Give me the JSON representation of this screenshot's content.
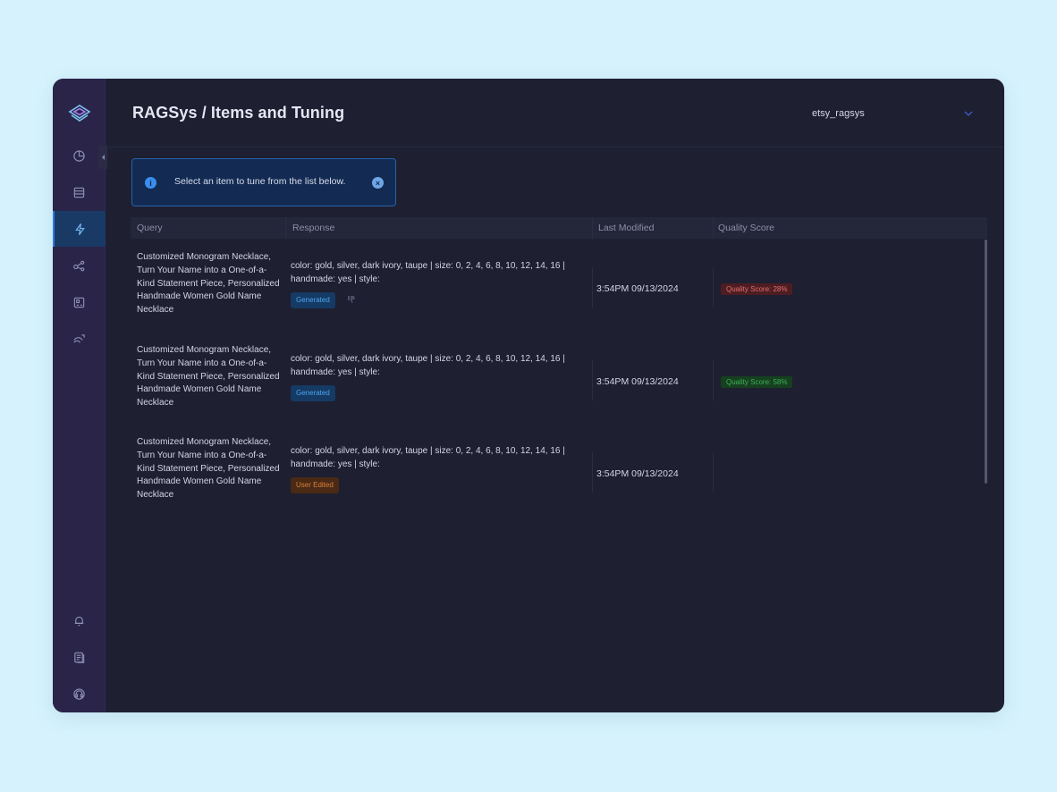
{
  "app": {
    "title": "RAGSys / Items and Tuning"
  },
  "workspace": {
    "selected": "etsy_ragsys"
  },
  "sidebar": {
    "items": [
      {
        "icon": "pie-chart-icon"
      },
      {
        "icon": "database-icon"
      },
      {
        "icon": "lightning-icon",
        "active": true
      },
      {
        "icon": "network-icon"
      },
      {
        "icon": "image-dashboard-icon"
      },
      {
        "icon": "wifi-pulse-icon"
      }
    ],
    "bottom": [
      {
        "icon": "bell-icon"
      },
      {
        "icon": "documents-icon"
      },
      {
        "icon": "headset-icon"
      }
    ]
  },
  "alert": {
    "message": "Select an item to tune from the list below.",
    "info_glyph": "i",
    "close_glyph": "×"
  },
  "table": {
    "headers": {
      "query": "Query",
      "response": "Response",
      "last_modified": "Last Modified",
      "quality_score": "Quality Score"
    },
    "rows": [
      {
        "query": "Customized Monogram Necklace, Turn Your Name into a One-of-a-Kind Statement Piece, Personalized Handmade Women Gold Name Necklace",
        "response": "color: gold, silver, dark ivory, taupe | size: 0, 2, 4, 6, 8, 10, 12, 14, 16 | handmade: yes | style:",
        "badge": "Generated",
        "last_modified": "3:54PM 09/13/2024",
        "quality_score": "Quality Score: 28%"
      },
      {
        "query": "Customized Monogram Necklace, Turn Your Name into a One-of-a-Kind Statement Piece, Personalized Handmade Women Gold Name Necklace",
        "response": "color: gold, silver, dark ivory, taupe | size: 0, 2, 4, 6, 8, 10, 12, 14, 16 | handmade: yes | style:",
        "badge": "Generated",
        "last_modified": "3:54PM 09/13/2024",
        "quality_score": "Quality Score: 58%"
      },
      {
        "query": "Customized Monogram Necklace, Turn Your Name into a One-of-a-Kind Statement Piece, Personalized Handmade Women Gold Name Necklace",
        "response": "color: gold, silver, dark ivory, taupe | size: 0, 2, 4, 6, 8, 10, 12, 14, 16 | handmade: yes | style:",
        "badge": "User Edited",
        "last_modified": "3:54PM 09/13/2024",
        "quality_score": ""
      }
    ]
  },
  "colors": {
    "page_bg": "#d6f3fd",
    "app_bg": "#1e1f31",
    "sidebar_bg": "#2a2449",
    "accent": "#2c7be5",
    "low_score": "#e36f6f",
    "mid_score": "#3fb05b",
    "edited": "#d9813a"
  }
}
